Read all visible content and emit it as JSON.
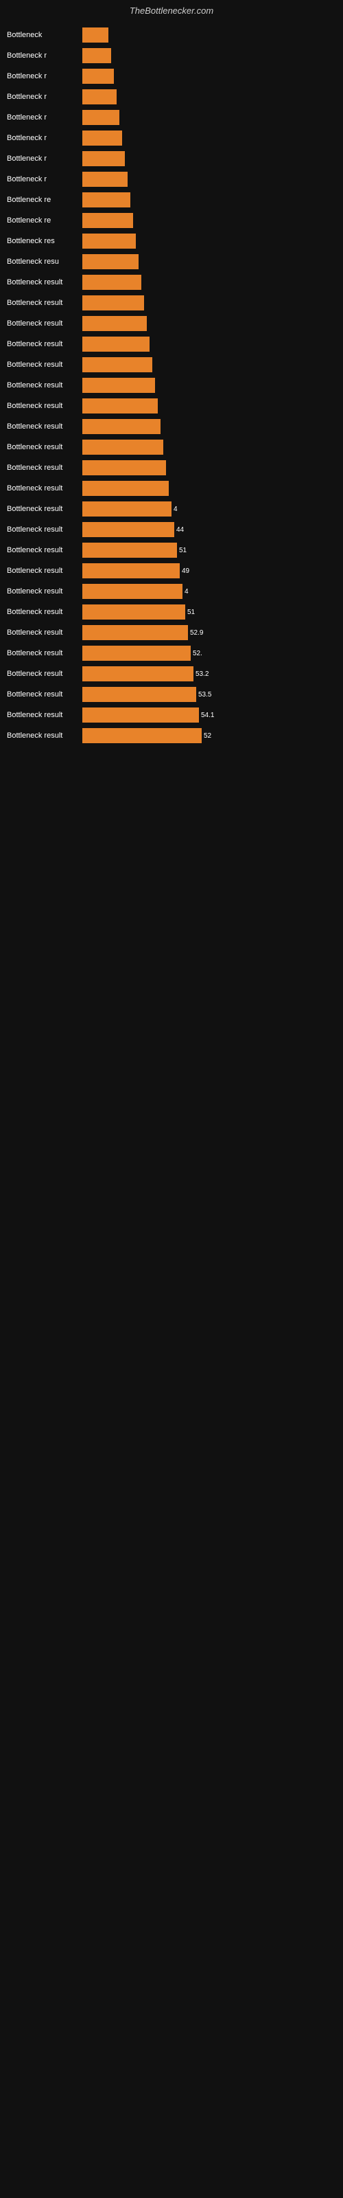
{
  "header": {
    "title": "TheBottlenecker.com"
  },
  "chart": {
    "bars": [
      {
        "label": "Bottleneck",
        "value": null,
        "width": 38
      },
      {
        "label": "Bottleneck r",
        "value": null,
        "width": 42
      },
      {
        "label": "Bottleneck r",
        "value": null,
        "width": 46
      },
      {
        "label": "Bottleneck r",
        "value": null,
        "width": 50
      },
      {
        "label": "Bottleneck r",
        "value": null,
        "width": 54
      },
      {
        "label": "Bottleneck r",
        "value": null,
        "width": 58
      },
      {
        "label": "Bottleneck r",
        "value": null,
        "width": 62
      },
      {
        "label": "Bottleneck r",
        "value": null,
        "width": 66
      },
      {
        "label": "Bottleneck re",
        "value": null,
        "width": 70
      },
      {
        "label": "Bottleneck re",
        "value": null,
        "width": 74
      },
      {
        "label": "Bottleneck res",
        "value": null,
        "width": 78
      },
      {
        "label": "Bottleneck resu",
        "value": null,
        "width": 82
      },
      {
        "label": "Bottleneck result",
        "value": null,
        "width": 86
      },
      {
        "label": "Bottleneck result",
        "value": null,
        "width": 90
      },
      {
        "label": "Bottleneck result",
        "value": null,
        "width": 94
      },
      {
        "label": "Bottleneck result",
        "value": null,
        "width": 98
      },
      {
        "label": "Bottleneck result",
        "value": null,
        "width": 102
      },
      {
        "label": "Bottleneck result",
        "value": null,
        "width": 106
      },
      {
        "label": "Bottleneck result",
        "value": null,
        "width": 110
      },
      {
        "label": "Bottleneck result",
        "value": null,
        "width": 114
      },
      {
        "label": "Bottleneck result",
        "value": null,
        "width": 118
      },
      {
        "label": "Bottleneck result",
        "value": null,
        "width": 122
      },
      {
        "label": "Bottleneck result",
        "value": null,
        "width": 126
      },
      {
        "label": "Bottleneck result",
        "value": "4",
        "width": 130
      },
      {
        "label": "Bottleneck result",
        "value": "44",
        "width": 134
      },
      {
        "label": "Bottleneck result",
        "value": "51",
        "width": 138
      },
      {
        "label": "Bottleneck result",
        "value": "49",
        "width": 142
      },
      {
        "label": "Bottleneck result",
        "value": "4",
        "width": 146
      },
      {
        "label": "Bottleneck result",
        "value": "51",
        "width": 150
      },
      {
        "label": "Bottleneck result",
        "value": "52.9",
        "width": 154
      },
      {
        "label": "Bottleneck result",
        "value": "52.",
        "width": 158
      },
      {
        "label": "Bottleneck result",
        "value": "53.2",
        "width": 162
      },
      {
        "label": "Bottleneck result",
        "value": "53.5",
        "width": 166
      },
      {
        "label": "Bottleneck result",
        "value": "54.1",
        "width": 170
      },
      {
        "label": "Bottleneck result",
        "value": "52",
        "width": 174
      }
    ]
  }
}
